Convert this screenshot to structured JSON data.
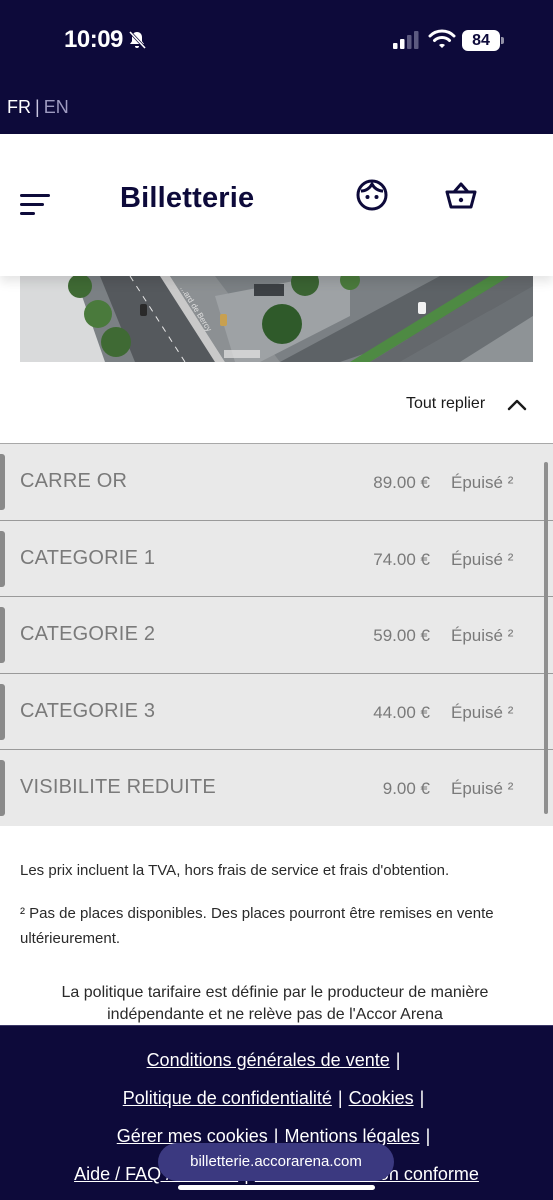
{
  "status_bar": {
    "time": "10:09",
    "battery": "84"
  },
  "lang": {
    "fr": "FR",
    "separator": "|",
    "en": "EN"
  },
  "header": {
    "brand": "Billetterie"
  },
  "hero": {
    "road_label": "...ard de Bercy"
  },
  "collapse": {
    "label": "Tout replier"
  },
  "prices": [
    {
      "name": "CARRE OR",
      "price": "89.00 €",
      "status": "Épuisé ²"
    },
    {
      "name": "CATEGORIE 1",
      "price": "74.00 €",
      "status": "Épuisé ²"
    },
    {
      "name": "CATEGORIE 2",
      "price": "59.00 €",
      "status": "Épuisé ²"
    },
    {
      "name": "CATEGORIE 3",
      "price": "44.00 €",
      "status": "Épuisé ²"
    },
    {
      "name": "VISIBILITE REDUITE",
      "price": "9.00 €",
      "status": "Épuisé ²"
    }
  ],
  "notes": {
    "vat": "Les prix incluent la TVA, hors frais de service et frais d'obtention.",
    "availability": "² Pas de places disponibles. Des places pourront être remises en vente ultérieurement."
  },
  "policy": "La politique tarifaire est définie par le producteur de manière indépendante et ne relève pas de l'Accor Arena",
  "footer": {
    "cgv": "Conditions générales de vente",
    "privacy": "Politique de confidentialité",
    "cookies": "Cookies",
    "manage_cookies": "Gérer mes cookies",
    "legal": "Mentions légales",
    "help": "Aide / FAQ / Contact",
    "accessibility": "Accessibilité : non conforme",
    "separator": "|"
  },
  "browser": {
    "url": "billetterie.accorarena.com"
  },
  "colors": {
    "navy": "#0d0a3a",
    "row_bg": "#e9e9e9",
    "muted_text": "#7a7a7a",
    "url_pill": "#3b3980"
  }
}
